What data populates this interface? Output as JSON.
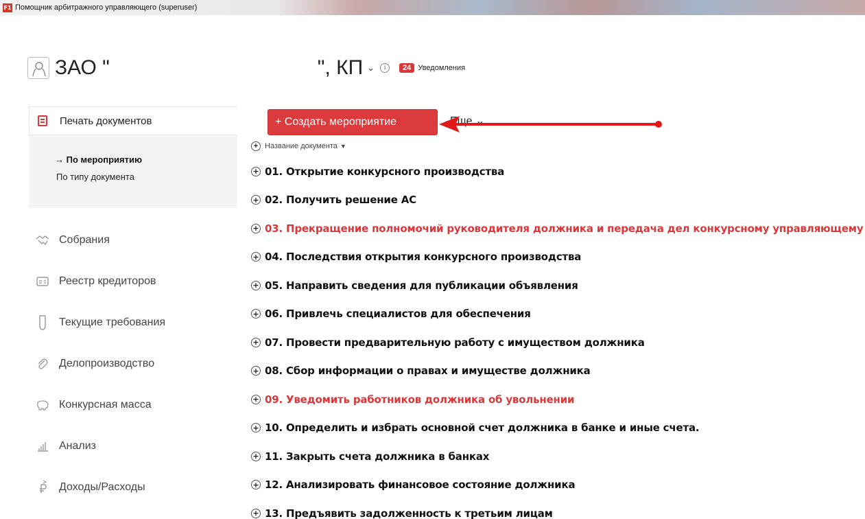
{
  "window": {
    "title": "Помощник арбитражного управляющего (superuser)",
    "app_badge": "F1"
  },
  "header": {
    "org_prefix": "ЗАО \"",
    "org_suffix": "\", КП",
    "notifications_count": "24",
    "notifications_label": "Уведомления"
  },
  "sidebar": {
    "section_title": "Печать документов",
    "subnav": {
      "active": "→ По мероприятию",
      "other": "По типу документа"
    },
    "items": [
      {
        "label": "Собрания",
        "icon": "handshake-icon"
      },
      {
        "label": "Реестр кредиторов",
        "icon": "id-card-icon"
      },
      {
        "label": "Текущие требования",
        "icon": "flask-icon"
      },
      {
        "label": "Делопроизводство",
        "icon": "paperclip-icon"
      },
      {
        "label": "Конкурсная масса",
        "icon": "piggy-bank-icon"
      },
      {
        "label": "Анализ",
        "icon": "bar-chart-icon"
      },
      {
        "label": "Доходы/Расходы",
        "icon": "ruble-icon"
      }
    ]
  },
  "toolbar": {
    "create_button": "+ Создать мероприятие",
    "more_label": "Еще ⌄"
  },
  "table": {
    "column_header": "Название документа",
    "rows": [
      {
        "title": "01. Открытие конкурсного производства",
        "highlight": false
      },
      {
        "title": "02. Получить решение АС",
        "highlight": false
      },
      {
        "title": "03. Прекращение полномочий руководителя должника и передача дел конкурсному управляющему",
        "highlight": true
      },
      {
        "title": "04. Последствия открытия конкурсного производства",
        "highlight": false
      },
      {
        "title": "05. Направить сведения для публикации объявления",
        "highlight": false
      },
      {
        "title": "06. Привлечь специалистов для обеспечения",
        "highlight": false
      },
      {
        "title": "07. Провести предварительную работу с имуществом должника",
        "highlight": false
      },
      {
        "title": "08. Сбор информации о правах и имуществе должника",
        "highlight": false
      },
      {
        "title": "09. Уведомить работников должника об увольнении",
        "highlight": true
      },
      {
        "title": "10. Определить и избрать основной счет должника в банке и иные счета.",
        "highlight": false
      },
      {
        "title": "11. Закрыть счета должника в банках",
        "highlight": false
      },
      {
        "title": "12. Анализировать финансовое состояние должника",
        "highlight": false
      },
      {
        "title": "13. Предъявить задолженность к третьим лицам",
        "highlight": false
      }
    ]
  },
  "colors": {
    "accent": "#dc3b3d",
    "highlight_text": "#d9383a"
  }
}
